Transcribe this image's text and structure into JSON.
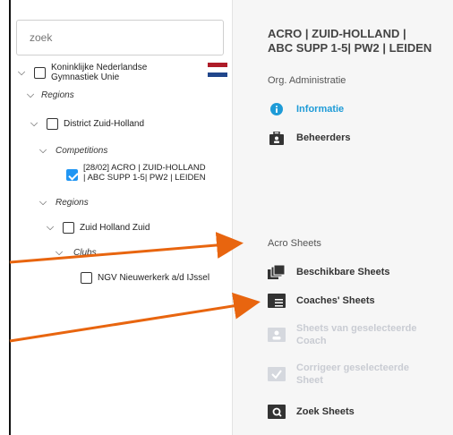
{
  "search": {
    "placeholder": "zoek"
  },
  "tree": {
    "root_label_line1": "Koninklijke Nederlandse",
    "root_label_line2": "Gymnastiek Unie",
    "regions_1": "Regions",
    "district": "District Zuid-Holland",
    "competitions": "Competitions",
    "competition_line1": "[28/02] ACRO | ZUID-HOLLAND",
    "competition_line2": "| ABC SUPP 1-5| PW2 | LEIDEN",
    "regions_2": "Regions",
    "zuid_holland_zuid": "Zuid Holland Zuid",
    "clubs": "Clubs",
    "club": "NGV Nieuwerkerk a/d IJssel"
  },
  "right": {
    "title_line1": "ACRO | ZUID-HOLLAND |",
    "title_line2": "ABC SUPP 1-5| PW2 | LEIDEN",
    "org_section": "Org. Administratie",
    "informatie": "Informatie",
    "beheerders": "Beheerders",
    "acro_section": "Acro Sheets",
    "beschikbare": "Beschikbare Sheets",
    "coaches": "Coaches' Sheets",
    "sheets_van_line1": "Sheets van geselecteerde",
    "sheets_van_line2": "Coach",
    "corrigeer_line1": "Corrigeer geselecteerde",
    "corrigeer_line2": "Sheet",
    "zoek_sheets": "Zoek Sheets"
  },
  "colors": {
    "accent_blue": "#1e9bd7",
    "checkbox_blue": "#2196f3",
    "arrow_orange": "#e8650f",
    "disabled_text": "#c9ccd3"
  },
  "icons": {
    "informatie": "info-circle-icon",
    "beheerders": "briefcase-user-icon",
    "beschikbare": "sheet-stack-icon",
    "coaches": "sheet-list-icon",
    "sheets_van": "sheet-user-icon",
    "corrigeer": "sheet-check-icon",
    "zoek_sheets": "sheet-search-icon",
    "flag": "netherlands-flag-icon"
  }
}
